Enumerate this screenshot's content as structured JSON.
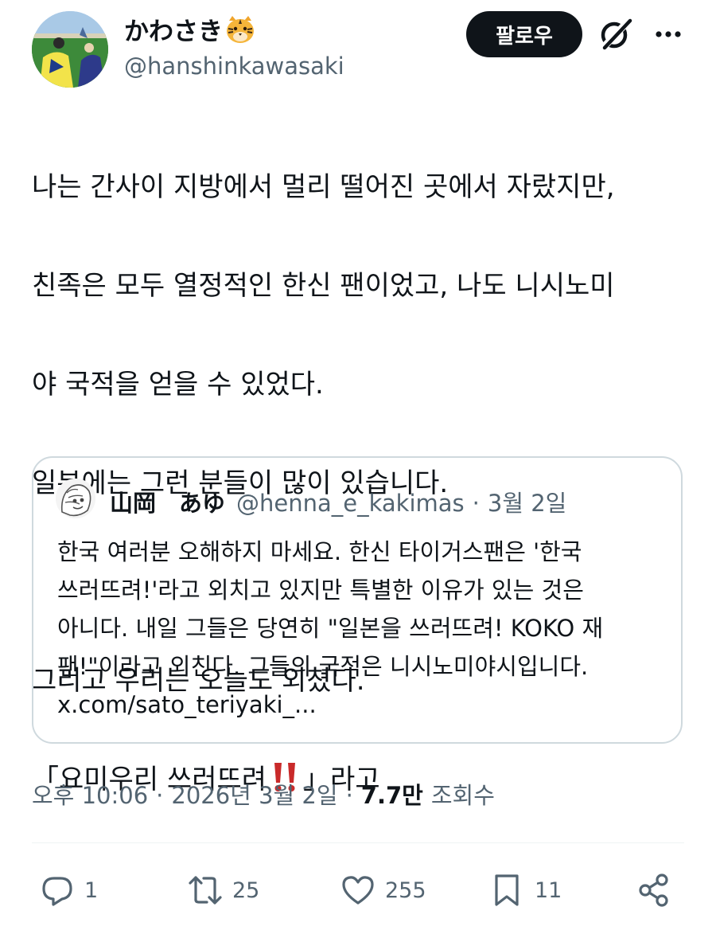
{
  "author": {
    "display_name": "かわさき",
    "handle": "@hanshinkawasaki"
  },
  "header": {
    "follow_label": "팔로우"
  },
  "tweet": {
    "lines": [
      "나는 간사이 지방에서 멀리 떨어진 곳에서 자랐지만,",
      "친족은 모두 열정적인 한신 팬이었고, 나도 니시노미",
      "야 국적을 얻을 수 있었다.",
      "일본에는 그런 분들이 많이 있습니다.",
      "",
      "그리고 우리는 오늘도 외쳤다."
    ],
    "last_line_before": "「요미우리 쓰러뜨려",
    "last_line_after": "」라고"
  },
  "quote": {
    "name": "山岡　あゆ",
    "handle": "@henna_e_kakimas",
    "separator": "·",
    "date": "3월 2일",
    "lines": [
      "한국 여러분 오해하지 마세요. 한신 타이거스팬은 '한국",
      "쓰러뜨려!'라고 외치고 있지만 특별한 이유가 있는 것은",
      "아니다. 내일 그들은 당연히 \"일본을 쓰러뜨려! KOKO 재",
      "팬!\"이라고 외친다. 그들의 국적은 니시노미야시입니다.",
      "x.com/sato_teriyaki_..."
    ]
  },
  "meta": {
    "time": "오후 10:06",
    "separator": "·",
    "date": "2026년 3월 2일",
    "views": "7.7만",
    "views_label": "조회수"
  },
  "actions": {
    "reply_count": "1",
    "retweet_count": "25",
    "like_count": "255",
    "bookmark_count": "11"
  },
  "colors": {
    "text_primary": "#0f1419",
    "text_secondary": "#536471",
    "border": "#cfd9de",
    "follow_bg": "#0f1419",
    "exclamation": "#c92a2a"
  },
  "icons": {
    "tiger": "tiger-face-emoji",
    "grok": "grok-icon",
    "more": "more-icon",
    "exclamation": "double-exclamation-emoji",
    "reply": "reply-icon",
    "retweet": "retweet-icon",
    "like": "heart-icon",
    "bookmark": "bookmark-icon",
    "share": "share-icon"
  }
}
